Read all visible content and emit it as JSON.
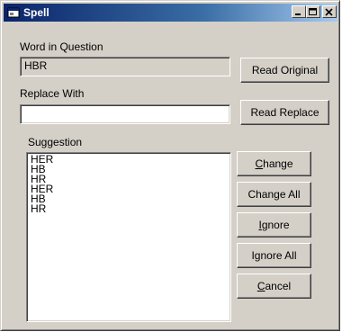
{
  "window": {
    "title": "Spell",
    "icon": "app-window-icon",
    "controls": [
      "minimize-icon",
      "maximize-icon",
      "close-icon"
    ]
  },
  "word_in_question": {
    "label": "Word in Question",
    "value": "HBR"
  },
  "replace_with": {
    "label": "Replace With",
    "value": ""
  },
  "suggestion": {
    "label": "Suggestion",
    "items": [
      "HER",
      "HB",
      "HR",
      "HER",
      "HB",
      "HR"
    ]
  },
  "buttons": {
    "read_original": "Read Original",
    "read_replace": "Read Replace",
    "change_mnemonic": "C",
    "change_rest": "hange",
    "change_all": "Change All",
    "ignore_mnemonic": "I",
    "ignore_rest": "gnore",
    "ignore_all": "Ignore All",
    "cancel_mnemonic": "C",
    "cancel_rest": "ancel"
  },
  "colors": {
    "face": "#d4d0c8",
    "title_start": "#0a246a",
    "title_end": "#a6caf0"
  }
}
